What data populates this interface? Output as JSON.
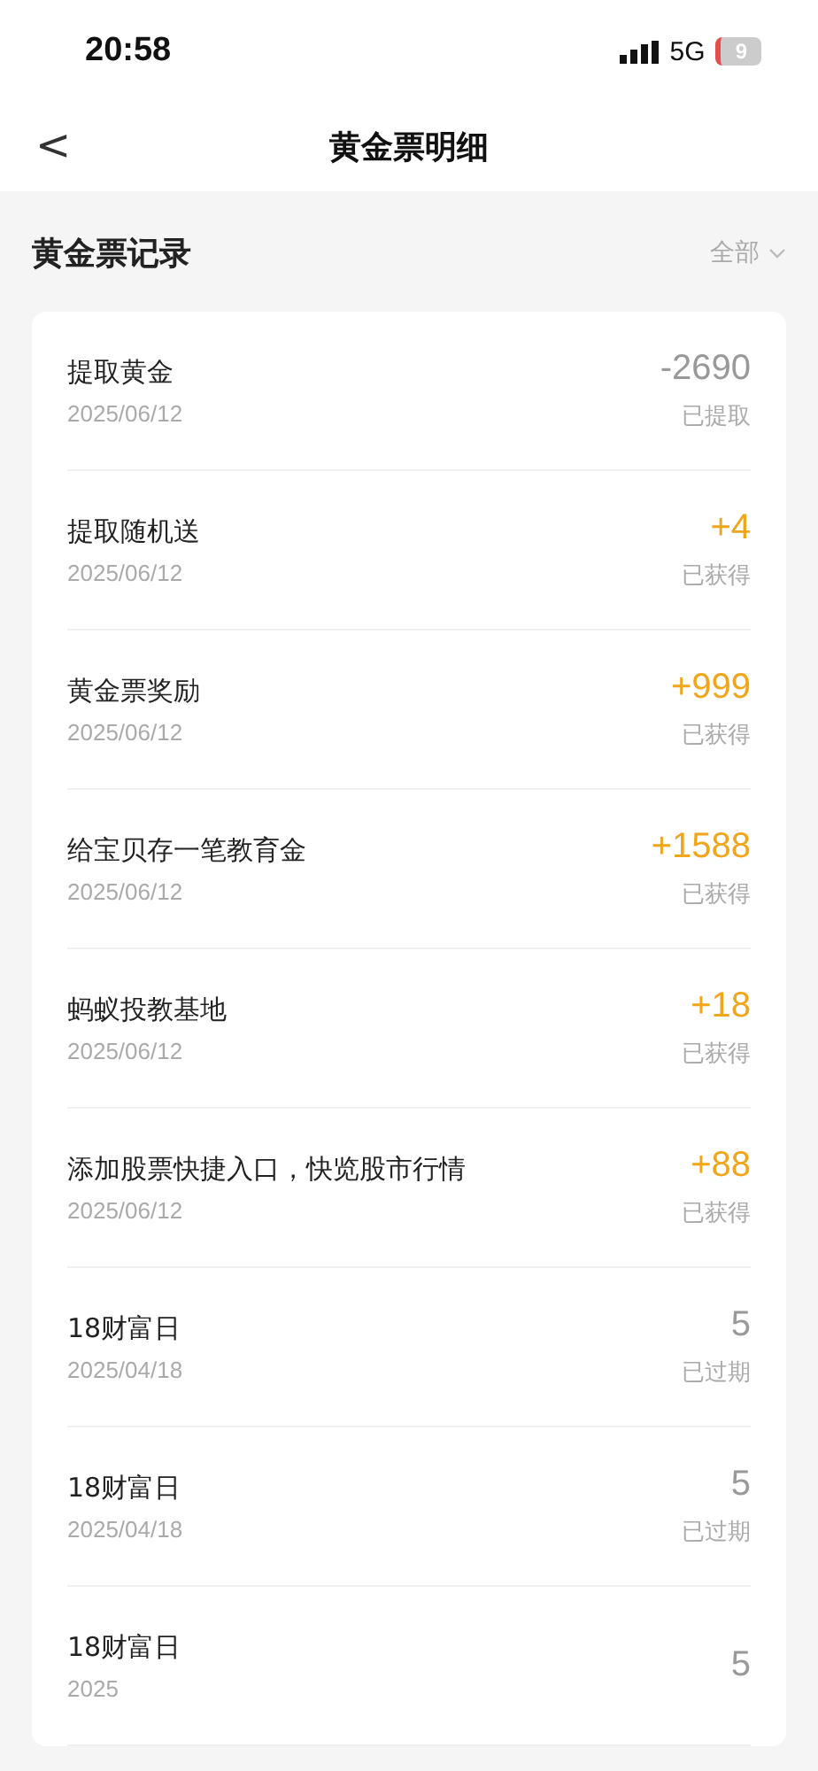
{
  "status_bar": {
    "time": "20:58",
    "network": "5G",
    "battery": "9"
  },
  "nav": {
    "back": "<",
    "title": "黄金票明细"
  },
  "section": {
    "title": "黄金票记录",
    "filter": "全部"
  },
  "records": [
    {
      "title": "提取黄金",
      "date": "2025/06/12",
      "amount": "-2690",
      "status": "已提取",
      "kind": "plain"
    },
    {
      "title": "提取随机送",
      "date": "2025/06/12",
      "amount": "+4",
      "status": "已获得",
      "kind": "gain"
    },
    {
      "title": "黄金票奖励",
      "date": "2025/06/12",
      "amount": "+999",
      "status": "已获得",
      "kind": "gain"
    },
    {
      "title": "给宝贝存一笔教育金",
      "date": "2025/06/12",
      "amount": "+1588",
      "status": "已获得",
      "kind": "gain"
    },
    {
      "title": "蚂蚁投教基地",
      "date": "2025/06/12",
      "amount": "+18",
      "status": "已获得",
      "kind": "gain"
    },
    {
      "title": "添加股票快捷入口，快览股市行情",
      "date": "2025/06/12",
      "amount": "+88",
      "status": "已获得",
      "kind": "gain"
    },
    {
      "title": "18财富日",
      "date": "2025/04/18",
      "amount": "5",
      "status": "已过期",
      "kind": "plain"
    },
    {
      "title": "18财富日",
      "date": "2025/04/18",
      "amount": "5",
      "status": "已过期",
      "kind": "plain"
    },
    {
      "title": "18财富日",
      "date": "2025",
      "amount": "5",
      "kind": "plain"
    }
  ]
}
